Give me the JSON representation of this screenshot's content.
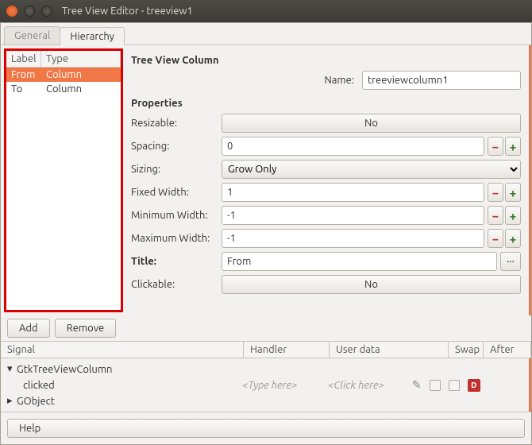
{
  "window": {
    "title": "Tree View Editor - treeview1"
  },
  "tabs": {
    "general": "General",
    "hierarchy": "Hierarchy"
  },
  "columns_list": {
    "header_label": "Label",
    "header_type": "Type",
    "rows": [
      {
        "label": "From",
        "type": "Column",
        "selected": true
      },
      {
        "label": "To",
        "type": "Column",
        "selected": false
      }
    ]
  },
  "main": {
    "heading": "Tree View Column",
    "name_label": "Name:",
    "name_value": "treeviewcolumn1",
    "properties_heading": "Properties",
    "props": {
      "resizable": {
        "label": "Resizable:",
        "value": "No"
      },
      "spacing": {
        "label": "Spacing:",
        "value": "0"
      },
      "sizing": {
        "label": "Sizing:",
        "value": "Grow Only"
      },
      "fixed_width": {
        "label": "Fixed Width:",
        "value": "1"
      },
      "min_width": {
        "label": "Minimum Width:",
        "value": "-1"
      },
      "max_width": {
        "label": "Maximum Width:",
        "value": "-1"
      },
      "title": {
        "label": "Title:",
        "value": "From"
      },
      "clickable": {
        "label": "Clickable:",
        "value": "No"
      }
    }
  },
  "buttons": {
    "add": "Add",
    "remove": "Remove",
    "help": "Help"
  },
  "signals": {
    "header": {
      "signal": "Signal",
      "handler": "Handler",
      "userdata": "User data",
      "swap": "Swap",
      "after": "After"
    },
    "group1": "GtkTreeViewColumn",
    "clicked": {
      "name": "clicked",
      "handler_ph": "<Type here>",
      "user_ph": "<Click here>"
    },
    "group2": "GObject"
  }
}
